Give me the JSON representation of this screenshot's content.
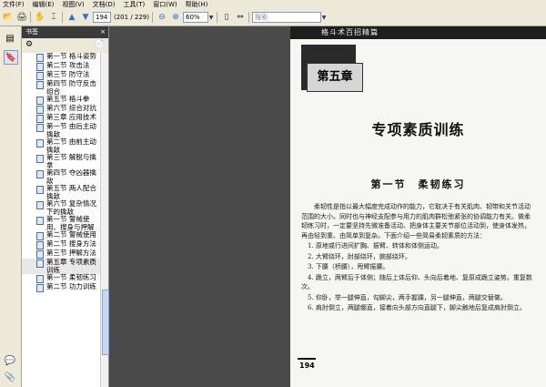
{
  "menu": [
    "文件(F)",
    "编辑(E)",
    "视图(V)",
    "文档(D)",
    "工具(T)",
    "窗口(W)",
    "帮助(H)"
  ],
  "toolbar": {
    "page_input": "194",
    "page_count": "(201 / 229)",
    "zoom": "60%",
    "search_placeholder": "搜索"
  },
  "bookmarks": {
    "title": "书签",
    "close": "×",
    "items": [
      {
        "label": "第一节 格斗姿势"
      },
      {
        "label": "第二节 攻击法"
      },
      {
        "label": "第三节 防守法"
      },
      {
        "label": "第四节 防守反击组合"
      },
      {
        "label": "第五节 格斗拳"
      },
      {
        "label": "第六节 综合对抗"
      },
      {
        "label": "第三章 应用技术"
      },
      {
        "label": "第一节 由后主动擒敌"
      },
      {
        "label": "第二节 由前主动擒敌"
      },
      {
        "label": "第三节 解脱与擒拿"
      },
      {
        "label": "第四节 夺凶器擒敌"
      },
      {
        "label": "第五节 两人配合擒敌"
      },
      {
        "label": "第六节 复杂情况下的擒敌"
      },
      {
        "label": "第一节 警械使用、搜身与押解"
      },
      {
        "label": "第二节 警械使用"
      },
      {
        "label": "第二节 搜身方法"
      },
      {
        "label": "第三节 押解方法"
      },
      {
        "label": "第五章 专项素质训练",
        "selected": true
      },
      {
        "label": "第一节 柔韧练习"
      },
      {
        "label": "第二节 功力训练"
      }
    ]
  },
  "page": {
    "header": "格斗术百招精篇",
    "chapter_label": "第五章",
    "chapter_title": "专项素质训练",
    "section_title": "第一节　柔韧练习",
    "paragraphs": [
      "柔韧性是指以最大幅度完成动作的能力，它取决于有关肌肉、韧带和关节活动范围的大小。同时也与神经支配参与用力的肌肉群松弛紧张的协调能力有关。做柔韧练习时，一定要坚持先微准备活动、把身体主要关节部位活动到，使身体发热，再由轻到重、由简单到复杂。下面介绍一些简易柔韧素质的方法：",
      "1. 原地或行进间扩胸、振臂、转体和体侧运动。",
      "2. 大臂绕环，肘部绕环，腕部绕环。",
      "3. 下腰（桥腰），甩臂振腰。",
      "4. 跪立，两臂后于体侧；随后上体后仰、头向后着地、复原成跪立姿势。重复数次。",
      "5. 仰卧，举一腿伸直，勾脚尖，两手握踝，另一腿伸直，两腿交替做。",
      "6. 肩肘倒立，两腿绷直，接着向头部方向直腿下，脚尖触地后复成肩肘倒立。"
    ],
    "page_number": "194"
  }
}
